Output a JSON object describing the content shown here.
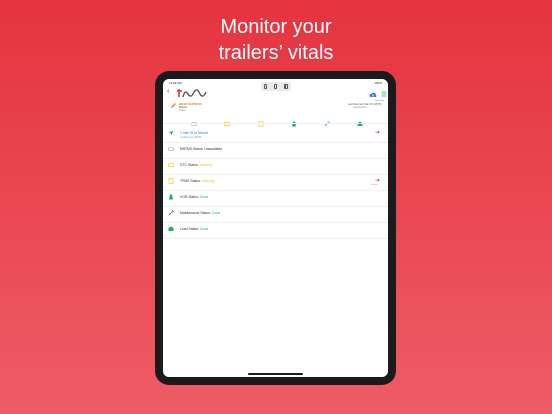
{
  "headline": {
    "line1": "Monitor your",
    "line2": "trailers’ vitals"
  },
  "status": {
    "time": "11:09 AM",
    "right": "100%"
  },
  "header": {
    "trailer_name": "BNSF1N4P6K66",
    "trailer_sub1": "Shared",
    "trailer_sub2": "Trailer",
    "update_line1": "Last Reported: Mar 23 2:48 PM",
    "update_line2": "Last Position:",
    "doc_label": "Inspection"
  },
  "tabs": [
    {
      "name": "Tires"
    },
    {
      "name": "Brakes"
    },
    {
      "name": "Power"
    },
    {
      "name": "Road"
    },
    {
      "name": "Maintenance"
    },
    {
      "name": "Load"
    }
  ],
  "rows": [
    {
      "title": "1 mile W of Moorie",
      "sub": "Location at 2:48 PM"
    },
    {
      "label": "EBPMS Status:",
      "value": "Unavailable"
    },
    {
      "label": "DTC Status:",
      "value": "Warning"
    },
    {
      "label": "TPMS Status:",
      "value": "Warning",
      "arrow_label": "6 alerts"
    },
    {
      "label": "VOR Status:",
      "value": "Good"
    },
    {
      "label": "Maintenance Status:",
      "value": "Good"
    },
    {
      "label": "Load Status:",
      "value": "Good"
    }
  ],
  "colors": {
    "accent": "#e4343f",
    "good": "#27ae60",
    "warning": "#f1c40f",
    "link": "#3a7dd8"
  }
}
